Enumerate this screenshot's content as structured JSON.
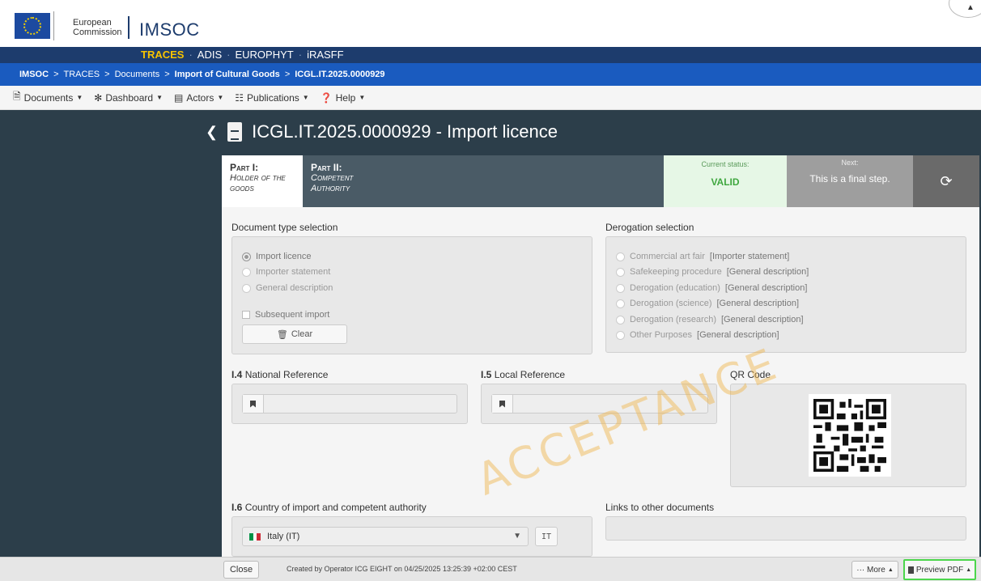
{
  "header": {
    "org_line1": "European",
    "org_line2": "Commission",
    "app_title": "IMSOC",
    "systems": [
      "TRACES",
      "ADIS",
      "EUROPHYT",
      "iRASFF"
    ],
    "systems_sep": "·"
  },
  "breadcrumb": [
    "IMSOC",
    "TRACES",
    "Documents",
    "Import of Cultural Goods",
    "ICGL.IT.2025.0000929"
  ],
  "breadcrumb_sep": ">",
  "menu": [
    {
      "label": "Documents",
      "icon": "document-icon"
    },
    {
      "label": "Dashboard",
      "icon": "dashboard-icon"
    },
    {
      "label": "Actors",
      "icon": "id-card-icon"
    },
    {
      "label": "Publications",
      "icon": "publication-icon"
    },
    {
      "label": "Help",
      "icon": "help-icon"
    }
  ],
  "document": {
    "title": "ICGL.IT.2025.0000929 - Import licence"
  },
  "tabs": [
    {
      "line1": "Part I:",
      "line2": "Holder of the goods",
      "active": true
    },
    {
      "line1": "Part II:",
      "line2": "Competent Authority",
      "active": false
    }
  ],
  "status": {
    "current_label": "Current status:",
    "current_value": "VALID",
    "next_label": "Next:",
    "next_value": "This is a final step."
  },
  "doc_type": {
    "label": "Document type selection",
    "options": [
      "Import licence",
      "Importer statement",
      "General description"
    ],
    "selected": "Import licence",
    "subsequent_label": "Subsequent import",
    "clear_label": "Clear"
  },
  "derogation": {
    "label": "Derogation selection",
    "options": [
      {
        "main": "Commercial art fair",
        "tag": "[Importer statement]"
      },
      {
        "main": "Safekeeping procedure",
        "tag": "[General description]"
      },
      {
        "main": "Derogation (education)",
        "tag": "[General description]"
      },
      {
        "main": "Derogation (science)",
        "tag": "[General description]"
      },
      {
        "main": "Derogation (research)",
        "tag": "[General description]"
      },
      {
        "main": "Other Purposes",
        "tag": "[General description]"
      }
    ]
  },
  "fields": {
    "national_ref_code": "I.4",
    "national_ref_label": "National Reference",
    "national_ref_value": "",
    "local_ref_code": "I.5",
    "local_ref_label": "Local Reference",
    "local_ref_value": "",
    "qr_label": "QR Code",
    "country_code": "I.6",
    "country_label": "Country of import and competent authority",
    "country_value": "Italy (IT)",
    "country_iso": "IT",
    "links_label": "Links to other documents"
  },
  "watermark": "ACCEPTANCE",
  "footer": {
    "close_label": "Close",
    "created_text": "Created by Operator ICG EIGHT on 04/25/2025 13:25:39 +02:00 CEST",
    "more_label": "··· More",
    "preview_label": "Preview PDF"
  },
  "colors": {
    "brand_dark": "#1d3c6d",
    "breadcrumb_blue": "#1a5bbf",
    "active_system": "#f8c300",
    "status_green": "#3fa73f",
    "highlight_green": "#4cd64c"
  }
}
